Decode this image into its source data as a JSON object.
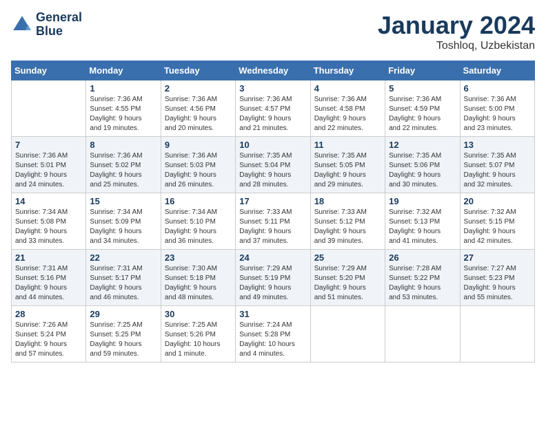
{
  "logo": {
    "line1": "General",
    "line2": "Blue"
  },
  "title": "January 2024",
  "location": "Toshloq, Uzbekistan",
  "headers": [
    "Sunday",
    "Monday",
    "Tuesday",
    "Wednesday",
    "Thursday",
    "Friday",
    "Saturday"
  ],
  "weeks": [
    [
      {
        "num": "",
        "info": ""
      },
      {
        "num": "1",
        "info": "Sunrise: 7:36 AM\nSunset: 4:55 PM\nDaylight: 9 hours\nand 19 minutes."
      },
      {
        "num": "2",
        "info": "Sunrise: 7:36 AM\nSunset: 4:56 PM\nDaylight: 9 hours\nand 20 minutes."
      },
      {
        "num": "3",
        "info": "Sunrise: 7:36 AM\nSunset: 4:57 PM\nDaylight: 9 hours\nand 21 minutes."
      },
      {
        "num": "4",
        "info": "Sunrise: 7:36 AM\nSunset: 4:58 PM\nDaylight: 9 hours\nand 22 minutes."
      },
      {
        "num": "5",
        "info": "Sunrise: 7:36 AM\nSunset: 4:59 PM\nDaylight: 9 hours\nand 22 minutes."
      },
      {
        "num": "6",
        "info": "Sunrise: 7:36 AM\nSunset: 5:00 PM\nDaylight: 9 hours\nand 23 minutes."
      }
    ],
    [
      {
        "num": "7",
        "info": "Sunrise: 7:36 AM\nSunset: 5:01 PM\nDaylight: 9 hours\nand 24 minutes."
      },
      {
        "num": "8",
        "info": "Sunrise: 7:36 AM\nSunset: 5:02 PM\nDaylight: 9 hours\nand 25 minutes."
      },
      {
        "num": "9",
        "info": "Sunrise: 7:36 AM\nSunset: 5:03 PM\nDaylight: 9 hours\nand 26 minutes."
      },
      {
        "num": "10",
        "info": "Sunrise: 7:35 AM\nSunset: 5:04 PM\nDaylight: 9 hours\nand 28 minutes."
      },
      {
        "num": "11",
        "info": "Sunrise: 7:35 AM\nSunset: 5:05 PM\nDaylight: 9 hours\nand 29 minutes."
      },
      {
        "num": "12",
        "info": "Sunrise: 7:35 AM\nSunset: 5:06 PM\nDaylight: 9 hours\nand 30 minutes."
      },
      {
        "num": "13",
        "info": "Sunrise: 7:35 AM\nSunset: 5:07 PM\nDaylight: 9 hours\nand 32 minutes."
      }
    ],
    [
      {
        "num": "14",
        "info": "Sunrise: 7:34 AM\nSunset: 5:08 PM\nDaylight: 9 hours\nand 33 minutes."
      },
      {
        "num": "15",
        "info": "Sunrise: 7:34 AM\nSunset: 5:09 PM\nDaylight: 9 hours\nand 34 minutes."
      },
      {
        "num": "16",
        "info": "Sunrise: 7:34 AM\nSunset: 5:10 PM\nDaylight: 9 hours\nand 36 minutes."
      },
      {
        "num": "17",
        "info": "Sunrise: 7:33 AM\nSunset: 5:11 PM\nDaylight: 9 hours\nand 37 minutes."
      },
      {
        "num": "18",
        "info": "Sunrise: 7:33 AM\nSunset: 5:12 PM\nDaylight: 9 hours\nand 39 minutes."
      },
      {
        "num": "19",
        "info": "Sunrise: 7:32 AM\nSunset: 5:13 PM\nDaylight: 9 hours\nand 41 minutes."
      },
      {
        "num": "20",
        "info": "Sunrise: 7:32 AM\nSunset: 5:15 PM\nDaylight: 9 hours\nand 42 minutes."
      }
    ],
    [
      {
        "num": "21",
        "info": "Sunrise: 7:31 AM\nSunset: 5:16 PM\nDaylight: 9 hours\nand 44 minutes."
      },
      {
        "num": "22",
        "info": "Sunrise: 7:31 AM\nSunset: 5:17 PM\nDaylight: 9 hours\nand 46 minutes."
      },
      {
        "num": "23",
        "info": "Sunrise: 7:30 AM\nSunset: 5:18 PM\nDaylight: 9 hours\nand 48 minutes."
      },
      {
        "num": "24",
        "info": "Sunrise: 7:29 AM\nSunset: 5:19 PM\nDaylight: 9 hours\nand 49 minutes."
      },
      {
        "num": "25",
        "info": "Sunrise: 7:29 AM\nSunset: 5:20 PM\nDaylight: 9 hours\nand 51 minutes."
      },
      {
        "num": "26",
        "info": "Sunrise: 7:28 AM\nSunset: 5:22 PM\nDaylight: 9 hours\nand 53 minutes."
      },
      {
        "num": "27",
        "info": "Sunrise: 7:27 AM\nSunset: 5:23 PM\nDaylight: 9 hours\nand 55 minutes."
      }
    ],
    [
      {
        "num": "28",
        "info": "Sunrise: 7:26 AM\nSunset: 5:24 PM\nDaylight: 9 hours\nand 57 minutes."
      },
      {
        "num": "29",
        "info": "Sunrise: 7:25 AM\nSunset: 5:25 PM\nDaylight: 9 hours\nand 59 minutes."
      },
      {
        "num": "30",
        "info": "Sunrise: 7:25 AM\nSunset: 5:26 PM\nDaylight: 10 hours\nand 1 minute."
      },
      {
        "num": "31",
        "info": "Sunrise: 7:24 AM\nSunset: 5:28 PM\nDaylight: 10 hours\nand 4 minutes."
      },
      {
        "num": "",
        "info": ""
      },
      {
        "num": "",
        "info": ""
      },
      {
        "num": "",
        "info": ""
      }
    ]
  ]
}
